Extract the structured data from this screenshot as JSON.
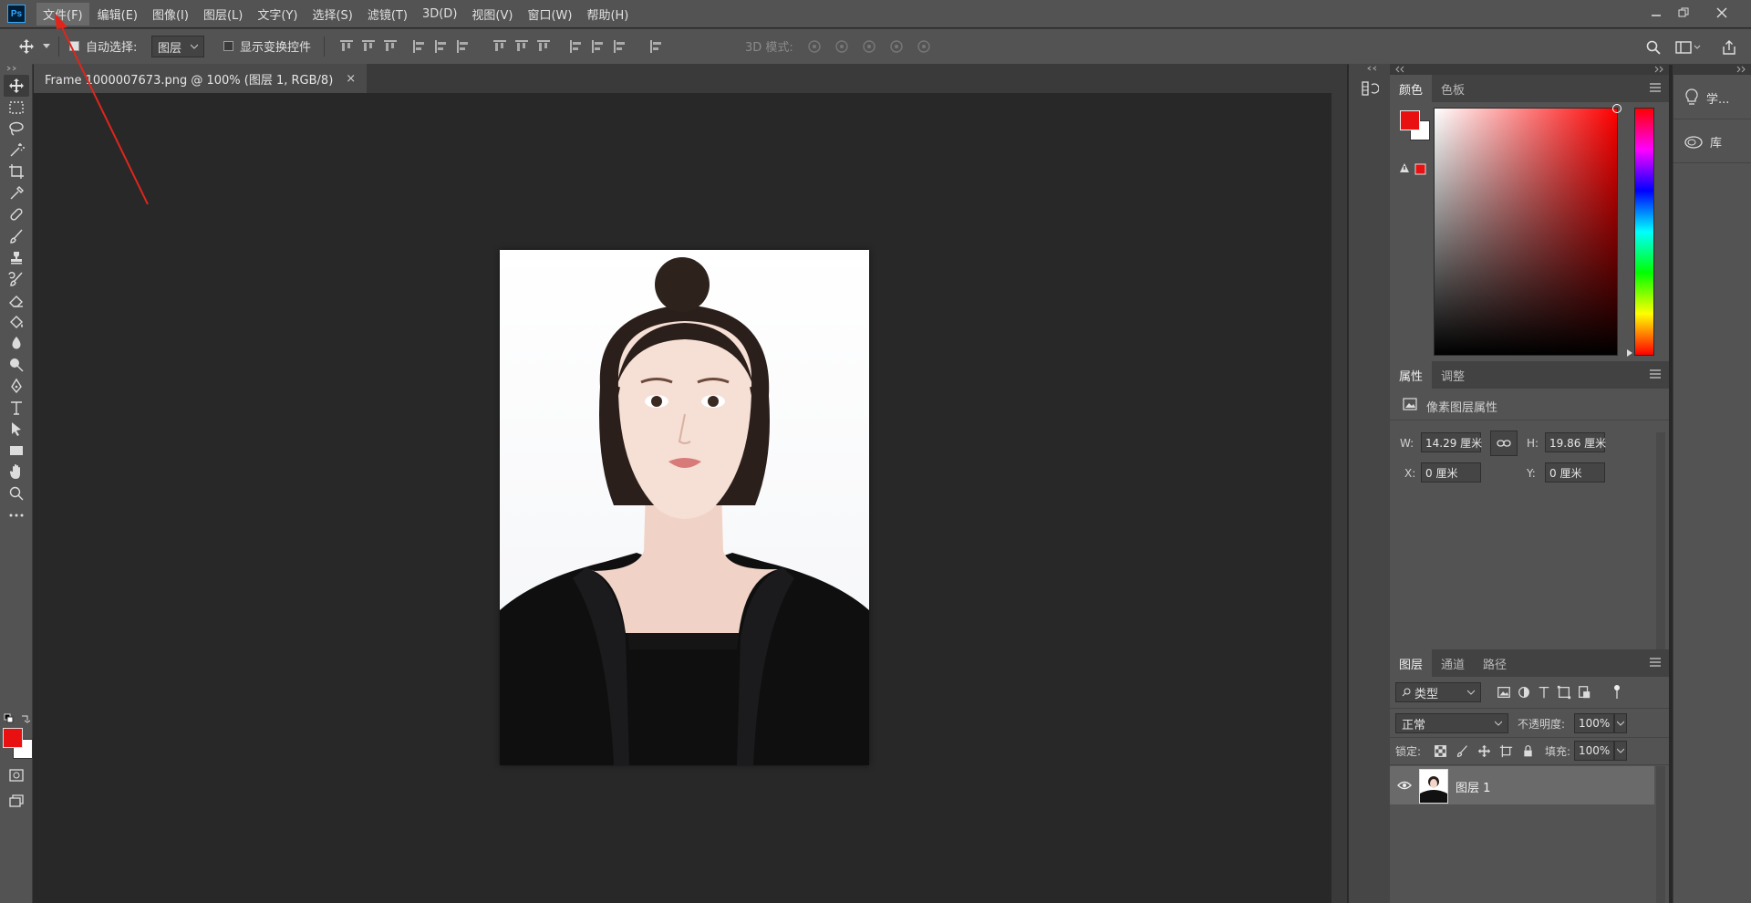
{
  "app": {
    "logo": "Ps"
  },
  "menu": [
    "文件(F)",
    "编辑(E)",
    "图像(I)",
    "图层(L)",
    "文字(Y)",
    "选择(S)",
    "滤镜(T)",
    "3D(D)",
    "视图(V)",
    "窗口(W)",
    "帮助(H)"
  ],
  "options": {
    "auto_select_label": "自动选择:",
    "auto_select_value": "图层",
    "show_transform_label": "显示变换控件",
    "mode_3d_label": "3D 模式:"
  },
  "document": {
    "tab_title": "Frame 1000007673.png @ 100% (图层 1, RGB/8)",
    "close": "×"
  },
  "color_panel": {
    "tabs": [
      "颜色",
      "色板"
    ],
    "foreground": "#e81010",
    "background": "#ffffff"
  },
  "properties_panel": {
    "tabs": [
      "属性",
      "调整"
    ],
    "title": "像素图层属性",
    "w_label": "W:",
    "w_value": "14.29 厘米",
    "h_label": "H:",
    "h_value": "19.86 厘米",
    "x_label": "X:",
    "x_value": "0 厘米",
    "y_label": "Y:",
    "y_value": "0 厘米"
  },
  "layers_panel": {
    "tabs": [
      "图层",
      "通道",
      "路径"
    ],
    "filter_label": "类型",
    "blend_mode": "正常",
    "opacity_label": "不透明度:",
    "opacity_value": "100%",
    "lock_label": "锁定:",
    "fill_label": "填充:",
    "fill_value": "100%",
    "layers": [
      {
        "name": "图层 1",
        "visible": true
      }
    ]
  },
  "right_dock": {
    "learn_label": "学...",
    "library_label": "库"
  },
  "colors": {
    "accent_arrow": "#e0261c",
    "toolbar_fg": "#e81010",
    "toolbar_bg": "#ffffff"
  }
}
